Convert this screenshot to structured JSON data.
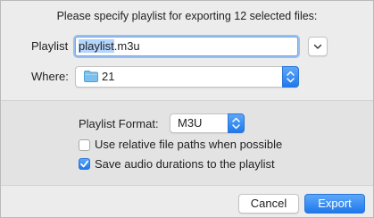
{
  "dialog": {
    "message": "Please specify playlist for exporting 12 selected files:"
  },
  "playlist": {
    "label": "Playlist",
    "filename_selected": "playlist",
    "filename_ext": ".m3u"
  },
  "where": {
    "label": "Where:",
    "folder": "21",
    "folder_icon": "folder-icon",
    "folder_color": "#7cc0ef"
  },
  "options": {
    "format_label": "Playlist Format:",
    "format_value": "M3U",
    "relative_paths_label": "Use relative file paths when possible",
    "relative_paths_checked": false,
    "save_durations_label": "Save audio durations to the playlist",
    "save_durations_checked": true
  },
  "buttons": {
    "cancel": "Cancel",
    "export": "Export"
  },
  "colors": {
    "accent": "#1f79ec",
    "selection": "#b3d4fc"
  }
}
